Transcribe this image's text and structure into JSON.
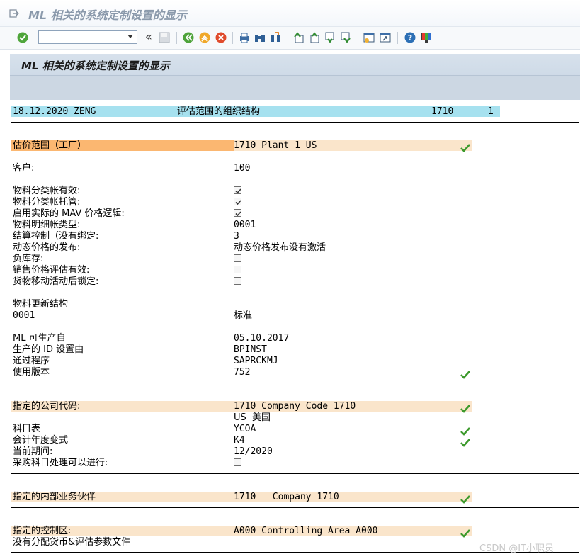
{
  "window": {
    "title": "ML 相关的系统定制设置的显示"
  },
  "toolbar": {
    "command_field_value": "",
    "icons": [
      "enter-icon",
      "back-icon",
      "exit-icon",
      "cancel-icon",
      "print-icon",
      "find-icon",
      "find-next-icon",
      "first-page-icon",
      "previous-page-icon",
      "next-page-icon",
      "last-page-icon",
      "create-session-icon",
      "shortcut-icon",
      "help-icon",
      "customize-layout-icon"
    ]
  },
  "page": {
    "title": "ML 相关的系统定制设置的显示"
  },
  "report_header": {
    "date_user": "18.12.2020 ZENG",
    "title": "评估范围的组织结构",
    "plant": "1710",
    "page_no": "1"
  },
  "valuation": {
    "label": "估价范围（工厂）",
    "value": "1710 Plant 1 US",
    "status": "ok"
  },
  "client": {
    "label": "客户:",
    "value": "100"
  },
  "settings": [
    {
      "label": "物料分类帐有效:",
      "type": "checkbox",
      "checked": true
    },
    {
      "label": "物料分类帐托管:",
      "type": "checkbox",
      "checked": true
    },
    {
      "label": "启用实际的 MAV 价格逻辑:",
      "type": "checkbox",
      "checked": true
    },
    {
      "label": "物料明细帐类型:",
      "type": "text",
      "value": "0001"
    },
    {
      "label": "结算控制（没有绑定:",
      "type": "text",
      "value": "3"
    },
    {
      "label": "动态价格的发布:",
      "type": "text",
      "value": "动态价格发布没有激活"
    },
    {
      "label": "负库存:",
      "type": "checkbox",
      "checked": false
    },
    {
      "label": "销售价格评估有效:",
      "type": "checkbox",
      "checked": false
    },
    {
      "label": "货物移动活动后锁定:",
      "type": "checkbox",
      "checked": false
    }
  ],
  "material_update": {
    "label": "物料更新结构",
    "code": "0001",
    "value": "标准"
  },
  "production": {
    "ml_productive_since_label": "ML 可生产自",
    "ml_productive_since": "05.10.2017",
    "id_set_by_label": "生产的 ID 设置由",
    "id_set_by": "BPINST",
    "via_program_label": "通过程序",
    "via_program": "SAPRCKMJ",
    "version_label": "使用版本",
    "version": "752"
  },
  "company": {
    "label": "指定的公司代码:",
    "value": "1710 Company Code 1710",
    "country": "US  美国",
    "coa_label": "科目表",
    "coa": "YCOA",
    "fy_variant_label": "会计年度变式",
    "fy_variant": "K4",
    "period_label": "当前期间:",
    "period": "12/2020",
    "purchase_label": "采购科目处理可以进行:",
    "purchase_checked": false
  },
  "partner": {
    "label": "指定的内部业务伙伴",
    "value": "1710   Company 1710"
  },
  "controlling": {
    "label": "指定的控制区:",
    "value": "A000 Controlling Area A000"
  },
  "note": "没有分配货币&评估参数文件",
  "watermark": "CSDN @IT小职员",
  "colors": {
    "header_band": "#a6e1ef",
    "highlight_orange": "#fbb771",
    "highlight_peach": "#fae5cb",
    "ok_green": "#3c9a2c"
  }
}
